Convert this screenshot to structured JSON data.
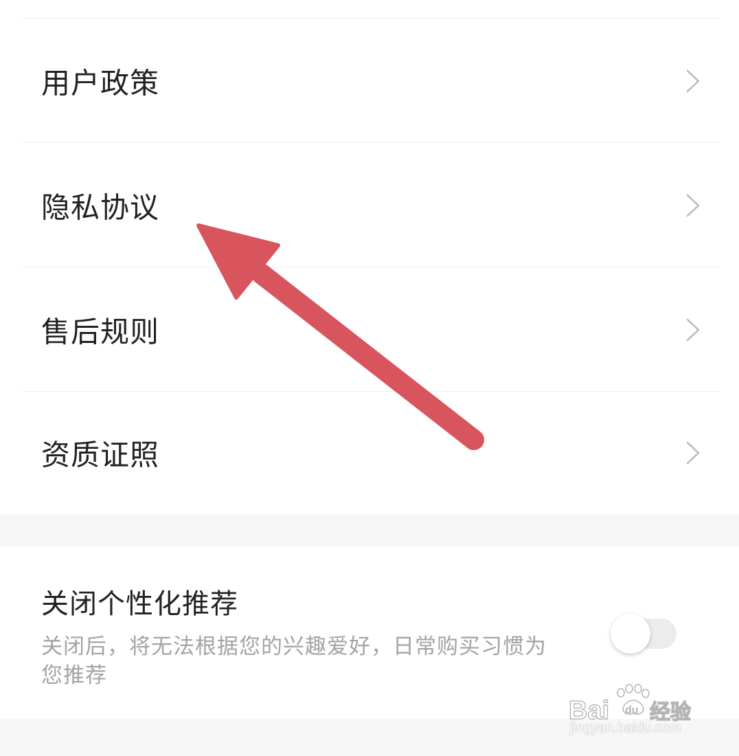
{
  "menu": {
    "items": [
      {
        "label": "用户政策"
      },
      {
        "label": "隐私协议"
      },
      {
        "label": "售后规则"
      },
      {
        "label": "资质证照"
      }
    ]
  },
  "personalization": {
    "title": "关闭个性化推荐",
    "description": "关闭后，将无法根据您的兴趣爱好，日常购买习惯为您推荐",
    "enabled": false
  },
  "overlay": {
    "arrow_color": "#d9555d",
    "arrow_points_to": "隐私协议"
  },
  "watermark": {
    "logo_text": "Bai du 经验",
    "url": "jingyan.baidu.com"
  },
  "colors": {
    "background": "#f7f7f7",
    "card": "#ffffff",
    "text_primary": "#222222",
    "text_secondary": "#a3a3a3",
    "chevron": "#bdbdbd"
  }
}
